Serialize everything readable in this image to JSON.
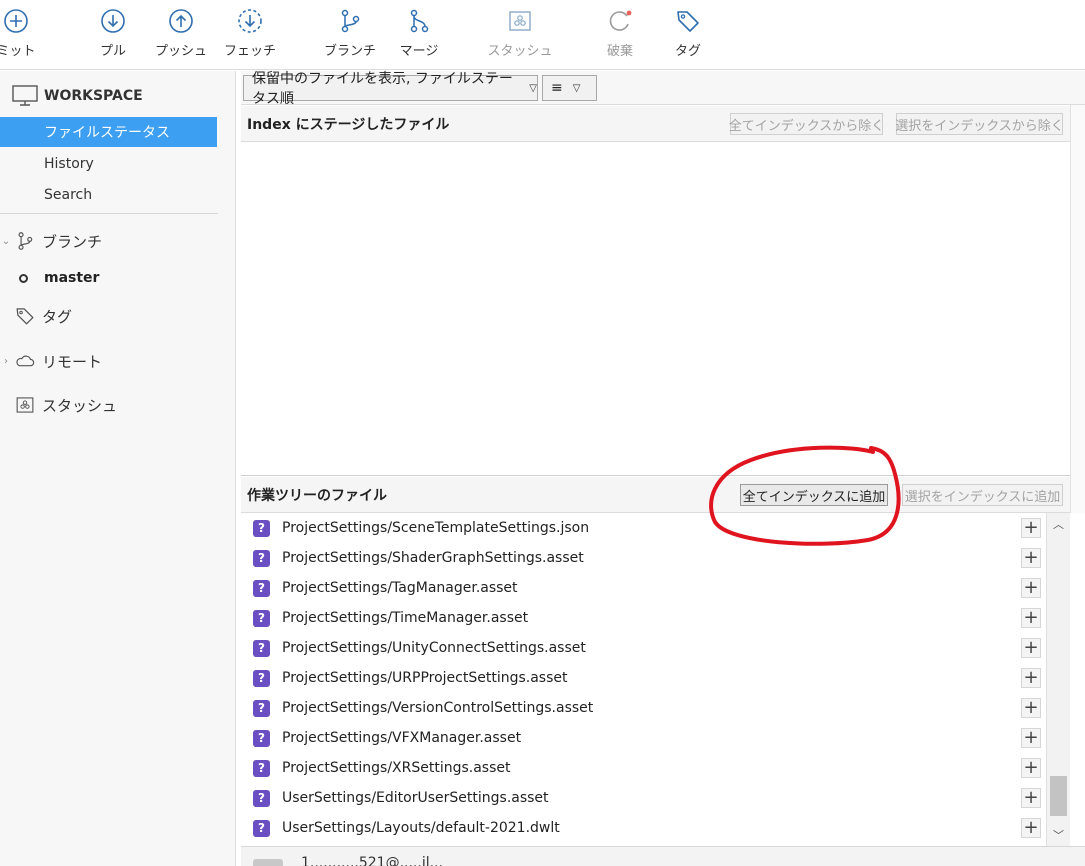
{
  "toolbar": {
    "commit": "ミット",
    "pull": "プル",
    "push": "プッシュ",
    "fetch": "フェッチ",
    "branch": "ブランチ",
    "merge": "マージ",
    "stash": "スタッシュ",
    "discard": "破棄",
    "tag": "タグ"
  },
  "sidebar": {
    "workspace": "WORKSPACE",
    "items": [
      "ファイルステータス",
      "History",
      "Search"
    ],
    "sections": {
      "branches": "ブランチ",
      "tags": "タグ",
      "remotes": "リモート",
      "stashes": "スタッシュ"
    },
    "current_branch": "master"
  },
  "filter": {
    "view_mode": "保留中のファイルを表示, ファイルステータス順",
    "list_icon": "≡"
  },
  "staged": {
    "title": "Index にステージしたファイル",
    "unstage_all": "全てインデックスから除く",
    "unstage_selected": "選択をインデックスから除く"
  },
  "working": {
    "title": "作業ツリーのファイル",
    "stage_all": "全てインデックスに追加",
    "stage_selected": "選択をインデックスに追加",
    "files": [
      "ProjectSettings/SceneTemplateSettings.json",
      "ProjectSettings/ShaderGraphSettings.asset",
      "ProjectSettings/TagManager.asset",
      "ProjectSettings/TimeManager.asset",
      "ProjectSettings/UnityConnectSettings.asset",
      "ProjectSettings/URPProjectSettings.asset",
      "ProjectSettings/VersionControlSettings.asset",
      "ProjectSettings/VFXManager.asset",
      "ProjectSettings/XRSettings.asset",
      "UserSettings/EditorUserSettings.asset",
      "UserSettings/Layouts/default-2021.dwlt"
    ],
    "file_status_glyph": "?",
    "add_glyph": "+"
  },
  "footer": {
    "author": "1...........521@.....il..."
  },
  "colors": {
    "accent": "#3d9ff2",
    "status_untracked": "#6a4fc3",
    "annotation": "#e0141e"
  }
}
